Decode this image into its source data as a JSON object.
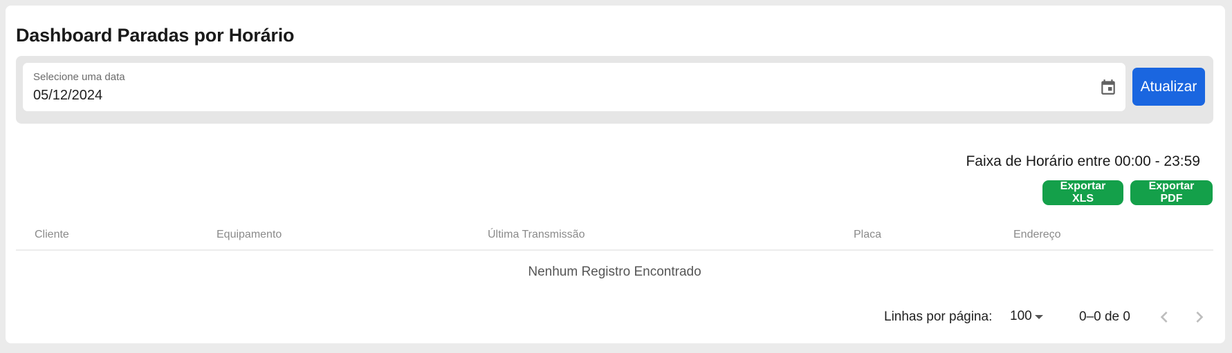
{
  "page": {
    "title": "Dashboard Paradas por Horário"
  },
  "filter": {
    "date_label": "Selecione uma data",
    "date_value": "05/12/2024",
    "update_button": "Atualizar"
  },
  "time_range": "Faixa de Horário entre 00:00 - 23:59",
  "export": {
    "xls_label": "Exportar XLS",
    "pdf_label": "Exportar PDF"
  },
  "table": {
    "columns": [
      "Cliente",
      "Equipamento",
      "Última Transmissão",
      "Placa",
      "Endereço"
    ],
    "rows": [],
    "empty_message": "Nenhum Registro Encontrado"
  },
  "pagination": {
    "rows_per_page_label": "Linhas por página:",
    "rows_per_page": "100",
    "range": "0–0 de 0"
  },
  "colors": {
    "primary": "#1a66e0",
    "export": "#14a04a",
    "background": "#ebebeb"
  },
  "icons": [
    "calendar-icon",
    "chevron-down-icon",
    "chevron-left-icon",
    "chevron-right-icon"
  ]
}
